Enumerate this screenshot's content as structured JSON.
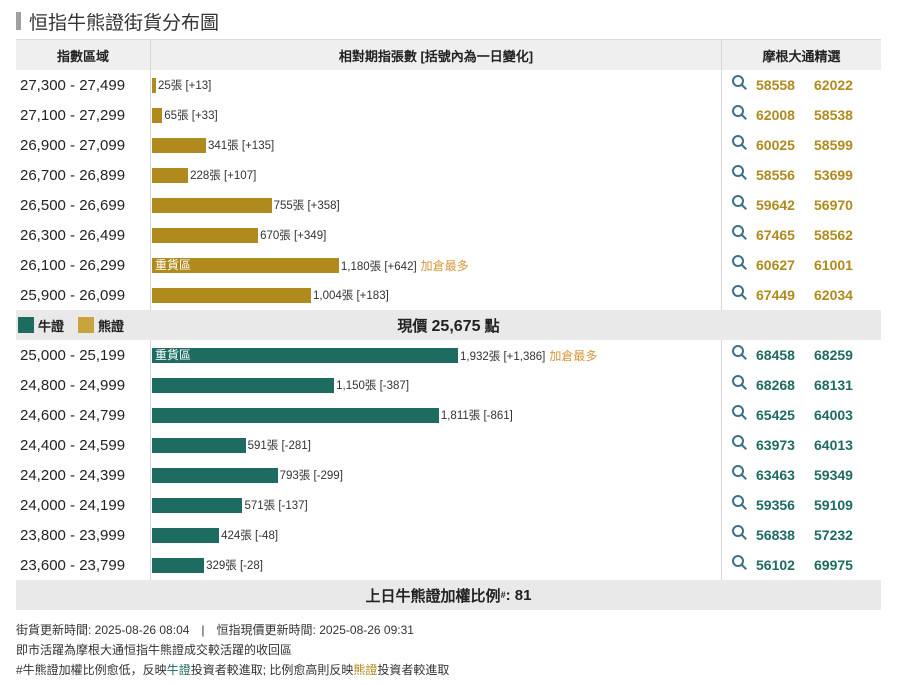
{
  "page_title": "恒指牛熊證街貨分布圖",
  "header": {
    "range": "指數區域",
    "count": "相對期指張數 [括號內為一日變化]",
    "picks": "摩根大通精選"
  },
  "bear_rows": [
    {
      "range": "27,300 - 27,499",
      "value": 25,
      "label": "25張 [+13]",
      "heavy": "",
      "hot": "",
      "codes": [
        "58558",
        "62022"
      ]
    },
    {
      "range": "27,100 - 27,299",
      "value": 65,
      "label": "65張 [+33]",
      "heavy": "",
      "hot": "",
      "codes": [
        "62008",
        "58538"
      ]
    },
    {
      "range": "26,900 - 27,099",
      "value": 341,
      "label": "341張 [+135]",
      "heavy": "",
      "hot": "",
      "codes": [
        "60025",
        "58599"
      ]
    },
    {
      "range": "26,700 - 26,899",
      "value": 228,
      "label": "228張 [+107]",
      "heavy": "",
      "hot": "",
      "codes": [
        "58556",
        "53699"
      ]
    },
    {
      "range": "26,500 - 26,699",
      "value": 755,
      "label": "755張 [+358]",
      "heavy": "",
      "hot": "",
      "codes": [
        "59642",
        "56970"
      ]
    },
    {
      "range": "26,300 - 26,499",
      "value": 670,
      "label": "670張 [+349]",
      "heavy": "",
      "hot": "",
      "codes": [
        "67465",
        "58562"
      ]
    },
    {
      "range": "26,100 - 26,299",
      "value": 1180,
      "label": "1,180張 [+642]",
      "heavy": "重貨區",
      "hot": "加倉最多",
      "codes": [
        "60627",
        "61001"
      ]
    },
    {
      "range": "25,900 - 26,099",
      "value": 1004,
      "label": "1,004張 [+183]",
      "heavy": "",
      "hot": "",
      "codes": [
        "67449",
        "62034"
      ]
    }
  ],
  "legend": {
    "bull": "牛證",
    "bear": "熊證"
  },
  "current_price": {
    "label": "現價",
    "value": "25,675",
    "unit": "點"
  },
  "bull_rows": [
    {
      "range": "25,000 - 25,199",
      "value": 1932,
      "label": "1,932張 [+1,386]",
      "heavy": "重貨區",
      "hot": "加倉最多",
      "codes": [
        "68458",
        "68259"
      ]
    },
    {
      "range": "24,800 - 24,999",
      "value": 1150,
      "label": "1,150張 [-387]",
      "heavy": "",
      "hot": "",
      "codes": [
        "68268",
        "68131"
      ]
    },
    {
      "range": "24,600 - 24,799",
      "value": 1811,
      "label": "1,811張 [-861]",
      "heavy": "",
      "hot": "",
      "codes": [
        "65425",
        "64003"
      ]
    },
    {
      "range": "24,400 - 24,599",
      "value": 591,
      "label": "591張 [-281]",
      "heavy": "",
      "hot": "",
      "codes": [
        "63973",
        "64013"
      ]
    },
    {
      "range": "24,200 - 24,399",
      "value": 793,
      "label": "793張 [-299]",
      "heavy": "",
      "hot": "",
      "codes": [
        "63463",
        "59349"
      ]
    },
    {
      "range": "24,000 - 24,199",
      "value": 571,
      "label": "571張 [-137]",
      "heavy": "",
      "hot": "",
      "codes": [
        "59356",
        "59109"
      ]
    },
    {
      "range": "23,800 - 23,999",
      "value": 424,
      "label": "424張 [-48]",
      "heavy": "",
      "hot": "",
      "codes": [
        "56838",
        "57232"
      ]
    },
    {
      "range": "23,600 - 23,799",
      "value": 329,
      "label": "329張 [-28]",
      "heavy": "",
      "hot": "",
      "codes": [
        "56102",
        "69975"
      ]
    }
  ],
  "ratio": {
    "label": "上日牛熊證加權比例",
    "mark": "#",
    "value": ": 81"
  },
  "notes": {
    "line1": "街貨更新時間: 2025-08-26 08:04　|　恒指現價更新時間: 2025-08-26 09:31",
    "line2": "即市活躍為摩根大通恒指牛熊證成交較活躍的收回區",
    "line3_a": "#牛熊證加權比例愈低，反映",
    "line3_bull": "牛證",
    "line3_b": "投資者較進取; 比例愈高則反映",
    "line3_bear": "熊證",
    "line3_c": "投資者較進取"
  },
  "colors": {
    "bull": "#1e6b62",
    "bear": "#b08a1c",
    "hot": "#d8963a"
  }
}
